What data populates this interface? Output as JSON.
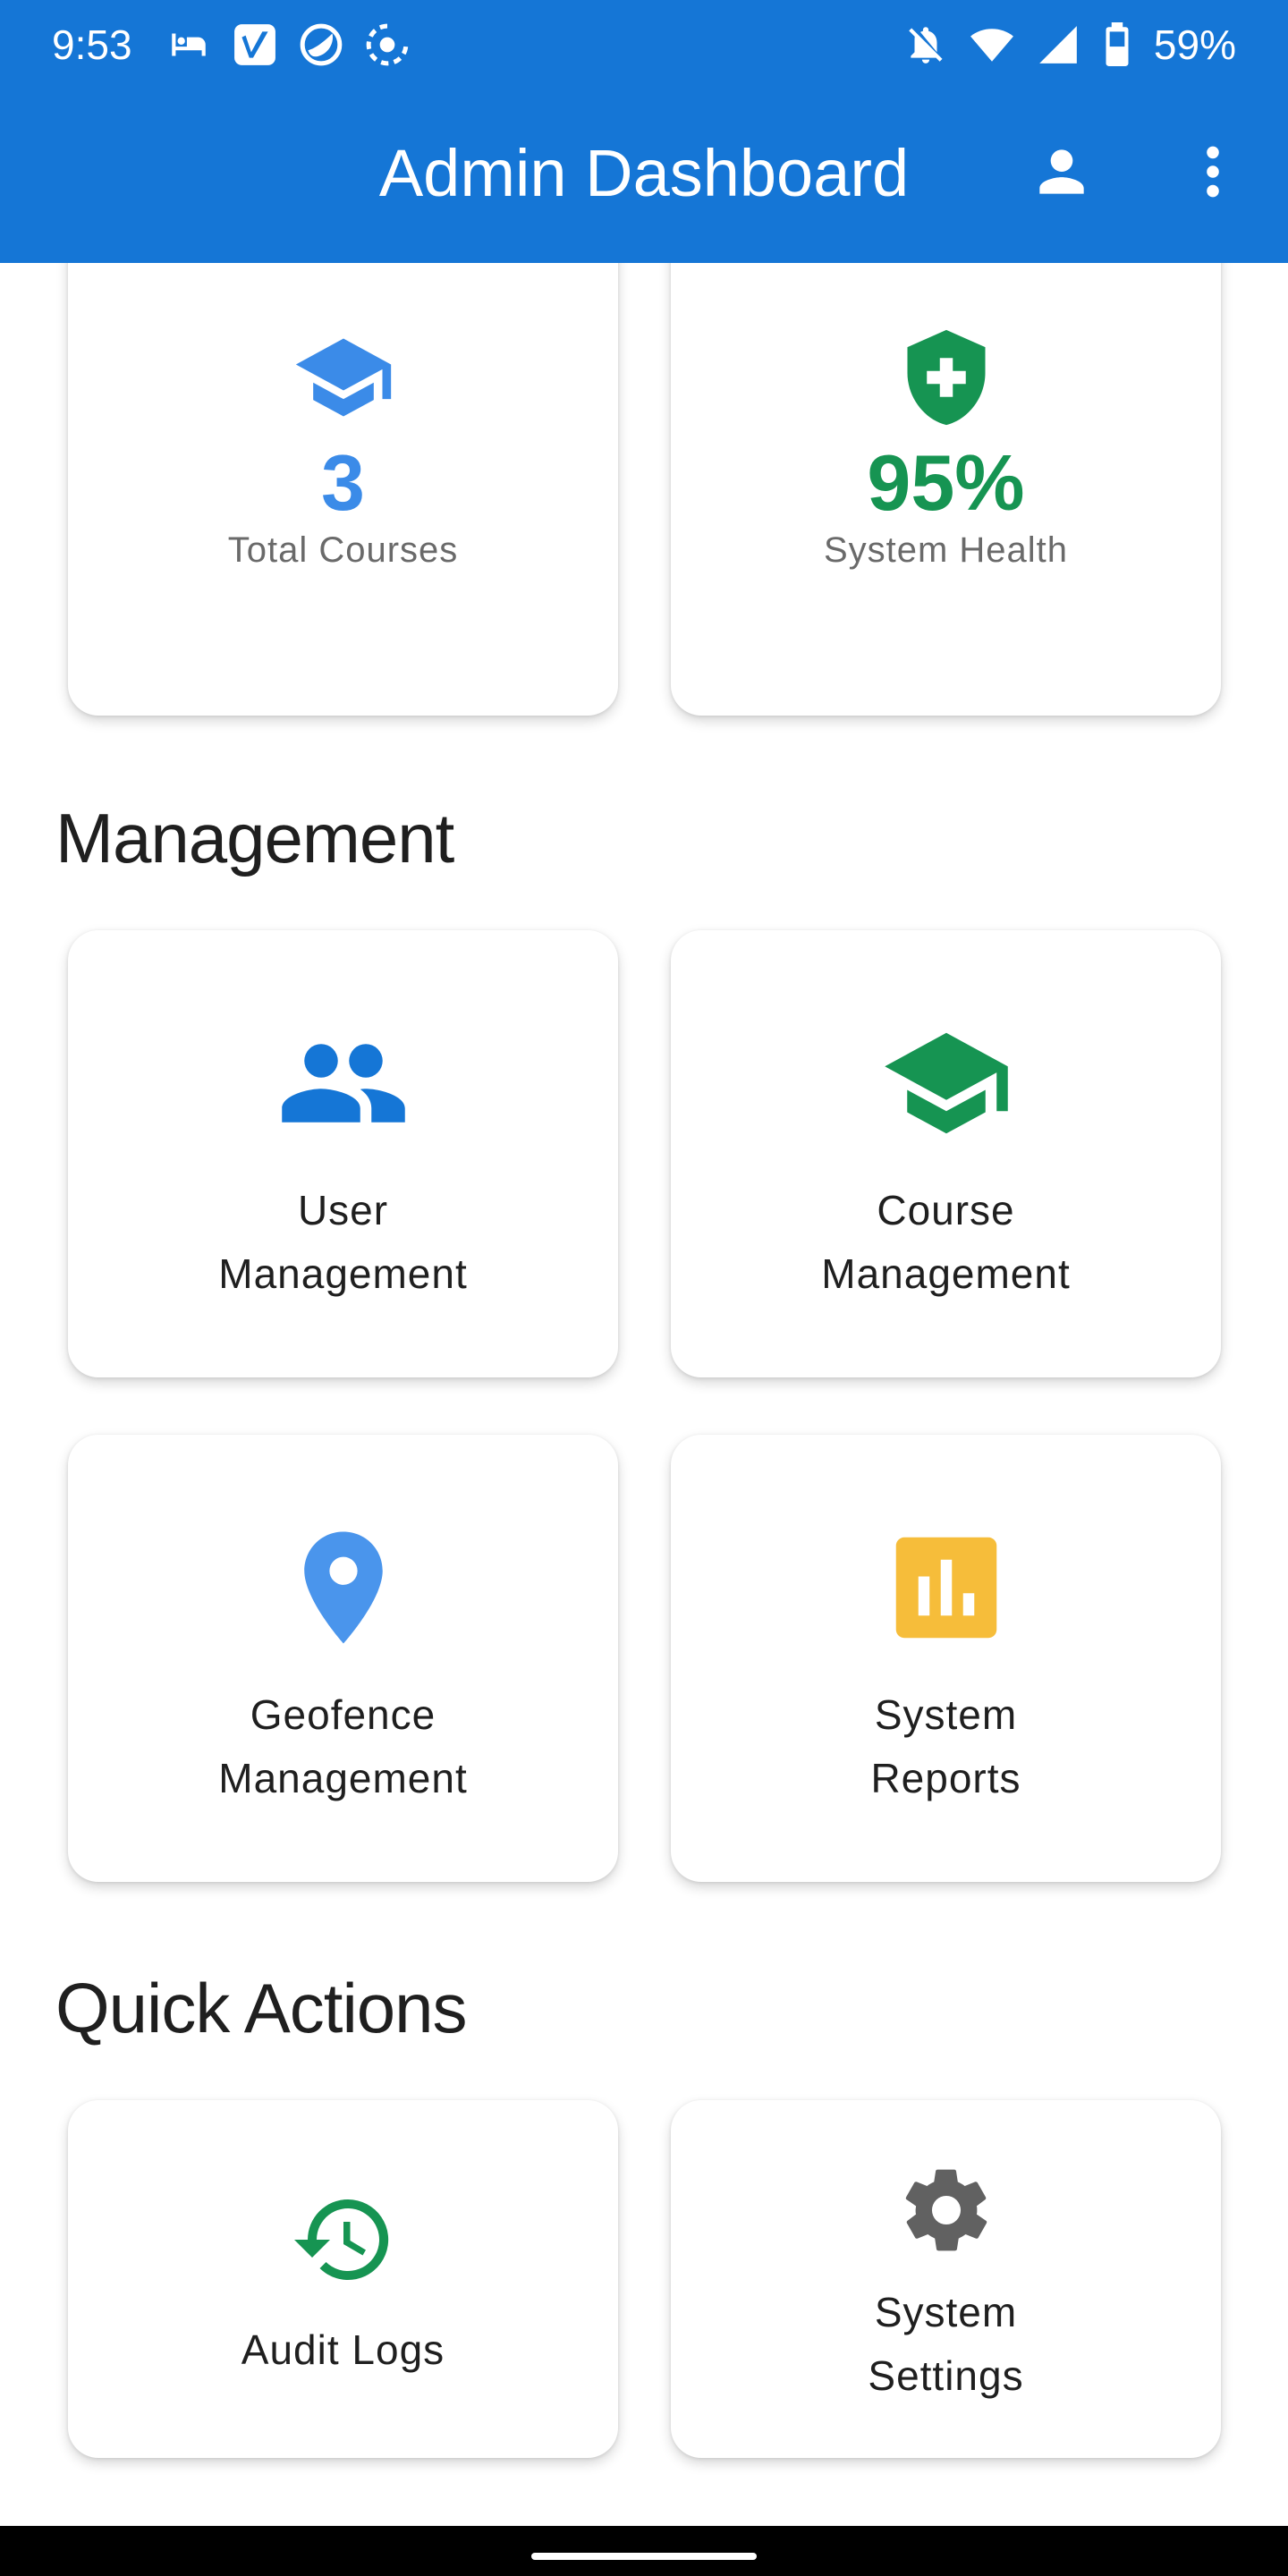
{
  "status_bar": {
    "time": "9:53",
    "battery": "59%",
    "left_icons": [
      "sleep-icon",
      "vimeo-icon",
      "app-icon",
      "record-icon"
    ],
    "right_icons": [
      "notifications-off-icon",
      "wifi-icon",
      "cellular-icon",
      "battery-icon"
    ]
  },
  "app_bar": {
    "title": "Admin Dashboard",
    "profile_icon": "person-icon",
    "menu_icon": "more-vert-icon",
    "background": "#1576d6"
  },
  "stats": [
    {
      "value": "3",
      "label": "Total Courses",
      "icon": "school-icon",
      "color": "#3b8be8"
    },
    {
      "value": "95%",
      "label": "System Health",
      "icon": "health-shield-icon",
      "color": "#169452"
    }
  ],
  "management": {
    "title": "Management",
    "items": [
      {
        "label": "User\nManagement",
        "icon": "people-icon",
        "color": "#1576d6"
      },
      {
        "label": "Course\nManagement",
        "icon": "school-icon",
        "color": "#169452"
      },
      {
        "label": "Geofence\nManagement",
        "icon": "location-pin-icon",
        "color": "#4a95ec"
      },
      {
        "label": "System\nReports",
        "icon": "bar-chart-icon",
        "color": "#f6bd3a"
      }
    ]
  },
  "quick_actions": {
    "title": "Quick Actions",
    "items": [
      {
        "label": "Audit Logs",
        "icon": "history-icon",
        "color": "#169452"
      },
      {
        "label": "System\nSettings",
        "icon": "gear-icon",
        "color": "#616161"
      }
    ]
  }
}
